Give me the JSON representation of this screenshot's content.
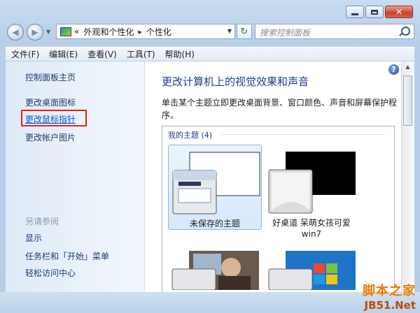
{
  "address": {
    "chevrons": "«",
    "crumb1": "外观和个性化",
    "crumb_sep": "▸",
    "crumb2": "个性化"
  },
  "search": {
    "placeholder": "搜索控制面板"
  },
  "menu": [
    "文件(F)",
    "编辑(E)",
    "查看(V)",
    "工具(T)",
    "帮助(H)"
  ],
  "sidebar": {
    "home": "控制面板主页",
    "links": [
      "更改桌面图标",
      "更改鼠标指针",
      "更改帐户图片"
    ],
    "see_also_title": "另请参阅",
    "see_also": [
      "显示",
      "任务栏和「开始」菜单",
      "轻松访问中心"
    ]
  },
  "main": {
    "title": "更改计算机上的视觉效果和声音",
    "description": "单击某个主题立即更改桌面背景、窗口颜色、声音和屏幕保护程序。",
    "group_label": "我的主题 (4)",
    "themes": [
      {
        "name": "未保存的主题",
        "selected": true
      },
      {
        "name": "好桌道 呆萌女孩可爱 win7",
        "selected": false
      }
    ]
  },
  "help_label": "?",
  "watermark": {
    "cn": "脚本之家",
    "en": "JB51.Net"
  },
  "colors": {
    "accent": "#1e3c96",
    "link": "#0b58c8",
    "highlight_box": "#e52222"
  }
}
